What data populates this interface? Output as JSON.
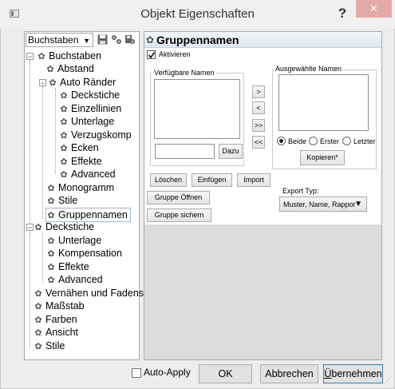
{
  "window": {
    "title": "Objekt Eigenschaften",
    "help": "?",
    "close": "✕"
  },
  "tree": {
    "dropdown_value": "Buchstaben",
    "items": [
      {
        "label": "Buchstaben"
      },
      {
        "label": "Abstand"
      },
      {
        "label": "Auto Ränder"
      },
      {
        "label": "Deckstiche"
      },
      {
        "label": "Einzellinien"
      },
      {
        "label": "Unterlage"
      },
      {
        "label": "Verzugskomp"
      },
      {
        "label": "Ecken"
      },
      {
        "label": "Effekte"
      },
      {
        "label": "Advanced"
      },
      {
        "label": "Monogramm"
      },
      {
        "label": "Stile"
      },
      {
        "label": "Gruppennamen"
      },
      {
        "label": "Deckstiche"
      },
      {
        "label": "Unterlage"
      },
      {
        "label": "Kompensation"
      },
      {
        "label": "Effekte"
      },
      {
        "label": "Advanced"
      },
      {
        "label": "Vernähen und Fadens"
      },
      {
        "label": "Maßstab"
      },
      {
        "label": "Farben"
      },
      {
        "label": "Ansicht"
      },
      {
        "label": "Stile"
      }
    ]
  },
  "panel": {
    "title": "Gruppennamen",
    "activate_label": "Aktivieren",
    "available_label": "Verfügbare Namen",
    "selected_label": "Ausgewählte Namen",
    "add_btn": ">",
    "remove_btn": "<",
    "add_all_btn": ">>",
    "remove_all_btn": "<<",
    "name_input_value": "",
    "dazu_btn": "Dazu",
    "radio_beide": "Beide",
    "radio_erster": "Erster",
    "radio_letzter": "Letzter",
    "kopieren_btn": "Kopieren*",
    "loeschen_btn": "Löschen",
    "einfuegen_btn": "Einfügen",
    "import_btn": "Import",
    "gruppe_oeffnen_btn": "Gruppe Öffnen",
    "gruppe_sichern_btn": "Gruppe sichern",
    "export_label": "Export Typ:",
    "export_value": "Muster, Name, Rappor"
  },
  "footer": {
    "auto_apply": "Auto-Apply",
    "ok": "OK",
    "cancel": "Abbrechen",
    "apply_prefix": "Ü",
    "apply_rest": "bernehmen"
  }
}
